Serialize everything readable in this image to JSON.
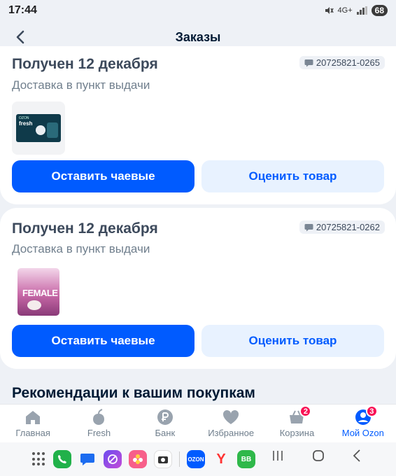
{
  "status": {
    "time": "17:44",
    "network": "4G+",
    "battery": "68"
  },
  "header": {
    "title": "Заказы"
  },
  "orders": [
    {
      "title": "Получен 12 декабря",
      "number": "20725821-0265",
      "delivery": "Доставка в пункт выдачи",
      "thumb_brand": "OZON",
      "thumb_title": "fresh",
      "tip_button": "Оставить чаевые",
      "rate_button": "Оценить товар"
    },
    {
      "title": "Получен 12 декабря",
      "number": "20725821-0262",
      "delivery": "Доставка в пункт выдачи",
      "thumb_title": "FEMALE",
      "tip_button": "Оставить чаевые",
      "rate_button": "Оценить товар"
    }
  ],
  "recommendations": {
    "title": "Рекомендации к вашим покупкам"
  },
  "bottom_nav": [
    {
      "label": "Главная",
      "icon": "home-icon"
    },
    {
      "label": "Fresh",
      "icon": "fresh-icon"
    },
    {
      "label": "Банк",
      "icon": "bank-icon"
    },
    {
      "label": "Избранное",
      "icon": "heart-icon"
    },
    {
      "label": "Корзина",
      "icon": "cart-icon",
      "badge": "2"
    },
    {
      "label": "Мой Ozon",
      "icon": "profile-icon",
      "badge": "3",
      "active": true
    }
  ],
  "dock": {
    "ozon_label": "OZON",
    "yandex_label": "Y",
    "vk_label": "BB"
  },
  "colors": {
    "primary": "#005bff",
    "secondary_bg": "#e8f2ff",
    "badge": "#f91155",
    "page_bg": "#eef1f6"
  }
}
